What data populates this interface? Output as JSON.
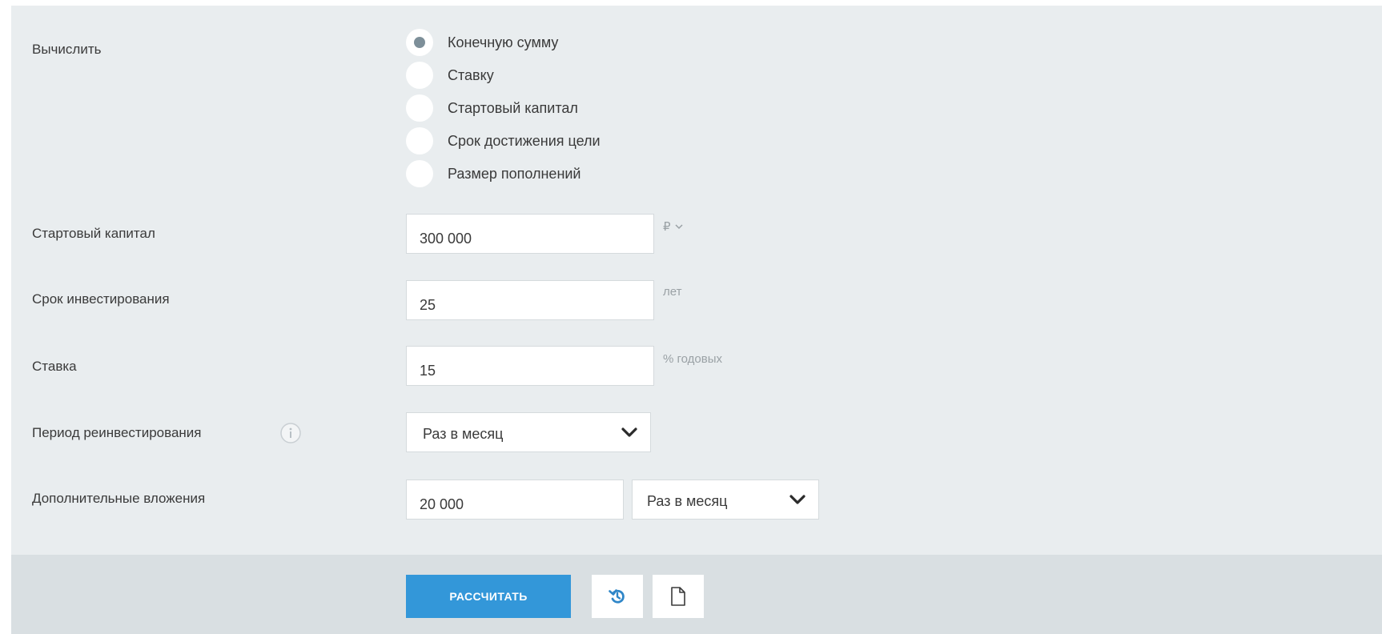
{
  "calculate": {
    "label": "Вычислить",
    "options": [
      {
        "label": "Конечную сумму",
        "checked": true
      },
      {
        "label": "Ставку",
        "checked": false
      },
      {
        "label": "Стартовый капитал",
        "checked": false
      },
      {
        "label": "Срок достижения цели",
        "checked": false
      },
      {
        "label": "Размер пополнений",
        "checked": false
      }
    ]
  },
  "start_capital": {
    "label": "Стартовый капитал",
    "value": "300 000",
    "unit": "₽"
  },
  "term": {
    "label": "Срок инвестирования",
    "value": "25",
    "unit": "лет"
  },
  "rate": {
    "label": "Ставка",
    "value": "15",
    "unit": "% годовых"
  },
  "reinvest_period": {
    "label": "Период реинвестирования",
    "value": "Раз в месяц",
    "info_icon": "info-circle-icon"
  },
  "additional": {
    "label": "Дополнительные вложения",
    "value": "20 000",
    "period": "Раз в месяц"
  },
  "footer": {
    "calculate_button": "РАССЧИТАТЬ",
    "reset_icon": "reset-icon",
    "document_icon": "document-icon"
  },
  "colors": {
    "panel_bg": "#e9edef",
    "footer_bg": "#d9dfe2",
    "primary": "#3397d9",
    "radio_dot": "#7d8f99"
  }
}
